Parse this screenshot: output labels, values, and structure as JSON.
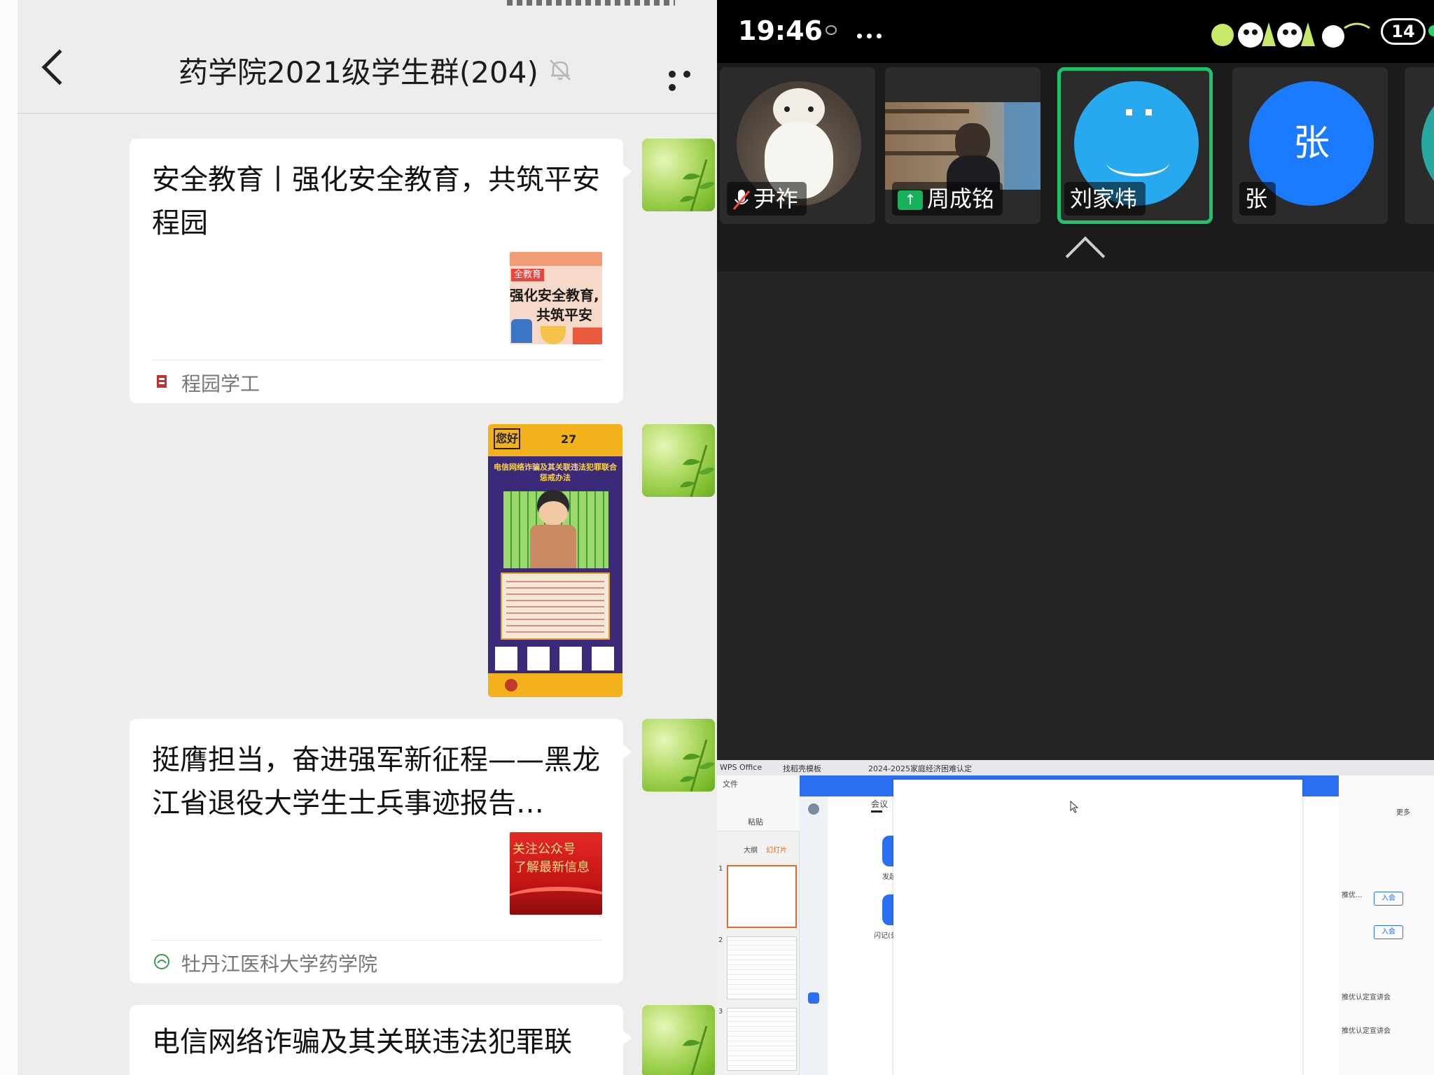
{
  "chat": {
    "title": "药学院2021级学生群(204)",
    "messages": [
      {
        "title": "安全教育丨强化安全教育，共筑平安程园",
        "thumb_lines": [
          "全教育",
          "强化安全教育,",
          "共筑平安"
        ],
        "source": "程园学工"
      },
      {
        "poster_heading": "电信网络诈骗及其关联违法犯罪联合惩戒办法",
        "poster_greeting": "您好",
        "poster_date": "27"
      },
      {
        "title": "挺膺担当，奋进强军新征程——黑龙江省退役大学生士兵事迹报告…",
        "thumb_lines": [
          "关注公众号",
          "了解最新信息"
        ],
        "source": "牡丹江医科大学药学院"
      },
      {
        "title": "电信网络诈骗及其关联违法犯罪联"
      }
    ]
  },
  "meeting": {
    "time": "19:46",
    "participant_count": "14",
    "participants": [
      {
        "name": "尹祚",
        "muted": true
      },
      {
        "name": "周成铭",
        "sharing": true
      },
      {
        "name": "刘家炜",
        "active": true
      },
      {
        "name": "张",
        "avatar_text": "张"
      }
    ],
    "shared_screen": {
      "tabs": [
        "WPS Office",
        "找稻壳模板",
        "2024-2025家庭经济困难认定"
      ],
      "menu_file": "文件",
      "paste_label": "粘贴",
      "outline_tab": "大纲",
      "slides_tab": "幻灯片",
      "dialog_title": "会议",
      "start_meeting": "发起会议",
      "flash_record": "闪记(录制)",
      "more_label": "更多",
      "join_label": "入会",
      "notice_1": "推优...",
      "notice_2": "推优认定宣讲会",
      "notice_3": "推优认定宣讲会",
      "slide_number_1": "1",
      "slide_number_2": "2",
      "slide_number_3": "3"
    }
  },
  "colors": {
    "chat_bg": "#ededed",
    "meeting_bg": "#232323",
    "active_speaker": "#1fc16b",
    "avatar_blue": "#1a7bff",
    "avatar_sky": "#27a9f0",
    "dialog_blue": "#2a6ef2"
  }
}
